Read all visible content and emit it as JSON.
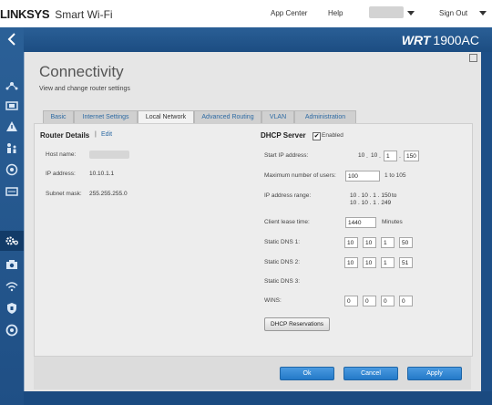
{
  "brand": {
    "logo": "LINKSYS",
    "product": "Smart Wi-Fi"
  },
  "topnav": {
    "app_center": "App Center",
    "help": "Help",
    "sign_out": "Sign Out"
  },
  "header": {
    "model_prefix": "WRT",
    "model_number": "1900AC"
  },
  "sidebar": {
    "icons": [
      "network-map-icon",
      "devices-icon",
      "alert-icon",
      "parental-controls-icon",
      "media-prioritization-icon",
      "speed-test-icon",
      "connectivity-gear-icon",
      "camera-icon",
      "wireless-icon",
      "security-shield-icon",
      "troubleshooting-icon"
    ],
    "active_color": "#123b68"
  },
  "page": {
    "title": "Connectivity",
    "subtitle": "View and change router settings"
  },
  "tabs": [
    {
      "label": "Basic"
    },
    {
      "label": "Internet Settings"
    },
    {
      "label": "Local Network"
    },
    {
      "label": "Advanced Routing"
    },
    {
      "label": "VLAN"
    },
    {
      "label": "Administration"
    }
  ],
  "router_details": {
    "heading": "Router Details",
    "separator": "|",
    "edit": "Edit",
    "host_name_label": "Host name:",
    "ip_label": "IP address:",
    "ip_value": "10.10.1.1",
    "subnet_label": "Subnet mask:",
    "subnet_value": "255.255.255.0"
  },
  "dhcp": {
    "heading": "DHCP Server",
    "enabled_label": "Enabled",
    "enabled_check": "✔",
    "start_ip_label": "Start IP address:",
    "start_ip": [
      "10",
      "10",
      "1",
      "150"
    ],
    "max_users_label": "Maximum number of users:",
    "max_users": "100",
    "max_users_range": "1 to 105",
    "ip_range_label": "IP address range:",
    "ip_range_from": "10 . 10 . 1 . 150",
    "ip_range_to_word": "to",
    "ip_range_to": "10 . 10 . 1 . 249",
    "lease_label": "Client lease time:",
    "lease_value": "1440",
    "lease_unit": "Minutes",
    "dns1_label": "Static DNS 1:",
    "dns1": [
      "10",
      "10",
      "1",
      "50"
    ],
    "dns2_label": "Static DNS 2:",
    "dns2": [
      "10",
      "10",
      "1",
      "51"
    ],
    "dns3_label": "Static DNS 3:",
    "wins_label": "WINS:",
    "wins": [
      "0",
      "0",
      "0",
      "0"
    ],
    "reservations_button": "DHCP Reservations"
  },
  "footer": {
    "ok": "Ok",
    "cancel": "Cancel",
    "apply": "Apply"
  },
  "colors": {
    "accent": "#2379c8",
    "header": "#1d4f87",
    "panel": "#e6e6e6",
    "link": "#2d6aa3"
  }
}
